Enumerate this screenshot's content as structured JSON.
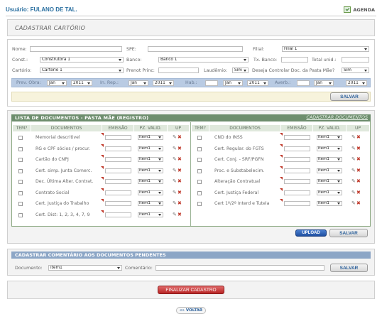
{
  "header": {
    "user": "Usuário: FULANO DE TAL.",
    "agenda": "AGENDA"
  },
  "title": "CADASTRAR CARTÓRIO",
  "form": {
    "nome_label": "Nome:",
    "nome_value": "",
    "spe_label": "SPE:",
    "spe_value": "",
    "filial_label": "Filial:",
    "filial_value": "Filial 1",
    "const_label": "Const.:",
    "const_value": "Construtora 1",
    "banco_label": "Banco:",
    "banco_value": "Banco 1",
    "txbanco_label": "Tx. Banco:",
    "txbanco_value": "",
    "totalunid_label": "Total unid.:",
    "totalunid_value": "",
    "cartorio_label": "Cartório:",
    "cartorio_value": "Cartório 1",
    "prenot_label": "Prenot Princ:",
    "prenot_value": "",
    "laudemio_label": "Laudêmio:",
    "laudemio_value": "Sim",
    "deseja_label": "Deseja Controlar Doc. da Pasta Mãe?",
    "deseja_value": "Sim",
    "prevobra_label": "Prev. Obra:",
    "prevobra_month": "Jan",
    "prevobra_year": "2011",
    "inrep_label": "In. Rep.:",
    "inrep_month": "Jan",
    "inrep_year": "2011",
    "hab_label": "Hab.:",
    "hab_day": "",
    "hab_month": "Jan",
    "hab_year": "2011",
    "averb_label": "Averb.:",
    "averb_day": "",
    "averb_month": "Jan",
    "averb_year": "2011",
    "save": "SALVAR"
  },
  "docs": {
    "title": "LISTA DE DOCUMENTOS - PASTA MÃE (REGISTRO)",
    "link": "CADASTRAR DOCUMENTOS",
    "cols": {
      "tem": "TEM?",
      "documentos": "DOCUMENTOS",
      "emissao": "EMISSÃO",
      "pz": "PZ. VALID.",
      "up": "UP"
    },
    "left": [
      {
        "name": "Memorial descritivel",
        "pz": "item1"
      },
      {
        "name": "RG e CPF sócios / procur.",
        "pz": "item1"
      },
      {
        "name": "Cartão do CNPJ",
        "pz": "item1"
      },
      {
        "name": "Cert. simp. Junta Comerc.",
        "pz": "item1"
      },
      {
        "name": "Dec. Última Alter. Contrat.",
        "pz": "item1"
      },
      {
        "name": "Contrato Social",
        "pz": "item1"
      },
      {
        "name": "Cert. Justiça do Trabalho",
        "pz": "item1"
      },
      {
        "name": "Cert. Dist: 1, 2, 3, 4, 7, 9",
        "pz": "item1"
      }
    ],
    "right": [
      {
        "name": "CND do INSS",
        "pz": "item1"
      },
      {
        "name": "Cert. Regular. do FGTS",
        "pz": "item1"
      },
      {
        "name": "Cert. Conj. - SRF/PGFN",
        "pz": "item1"
      },
      {
        "name": "Proc. e Substabelecim.",
        "pz": "item1"
      },
      {
        "name": "Alteração Contratual",
        "pz": "item1"
      },
      {
        "name": "Cert. Justiça Federal",
        "pz": "item1"
      },
      {
        "name": "Cert 1º/2º Interd e Tutela",
        "pz": "item1"
      }
    ],
    "upload": "UPLOAD",
    "save": "SALVAR"
  },
  "comment": {
    "title": "CADASTRAR COMENTÁRIO AOS DOCUMENTOS PENDENTES",
    "doc_label": "Documento:",
    "doc_value": "item1",
    "com_label": "Comentário:",
    "com_value": "",
    "save": "SALVAR"
  },
  "finalizar": "FINALIZAR CADASTRO",
  "voltar": "VOLTAR"
}
